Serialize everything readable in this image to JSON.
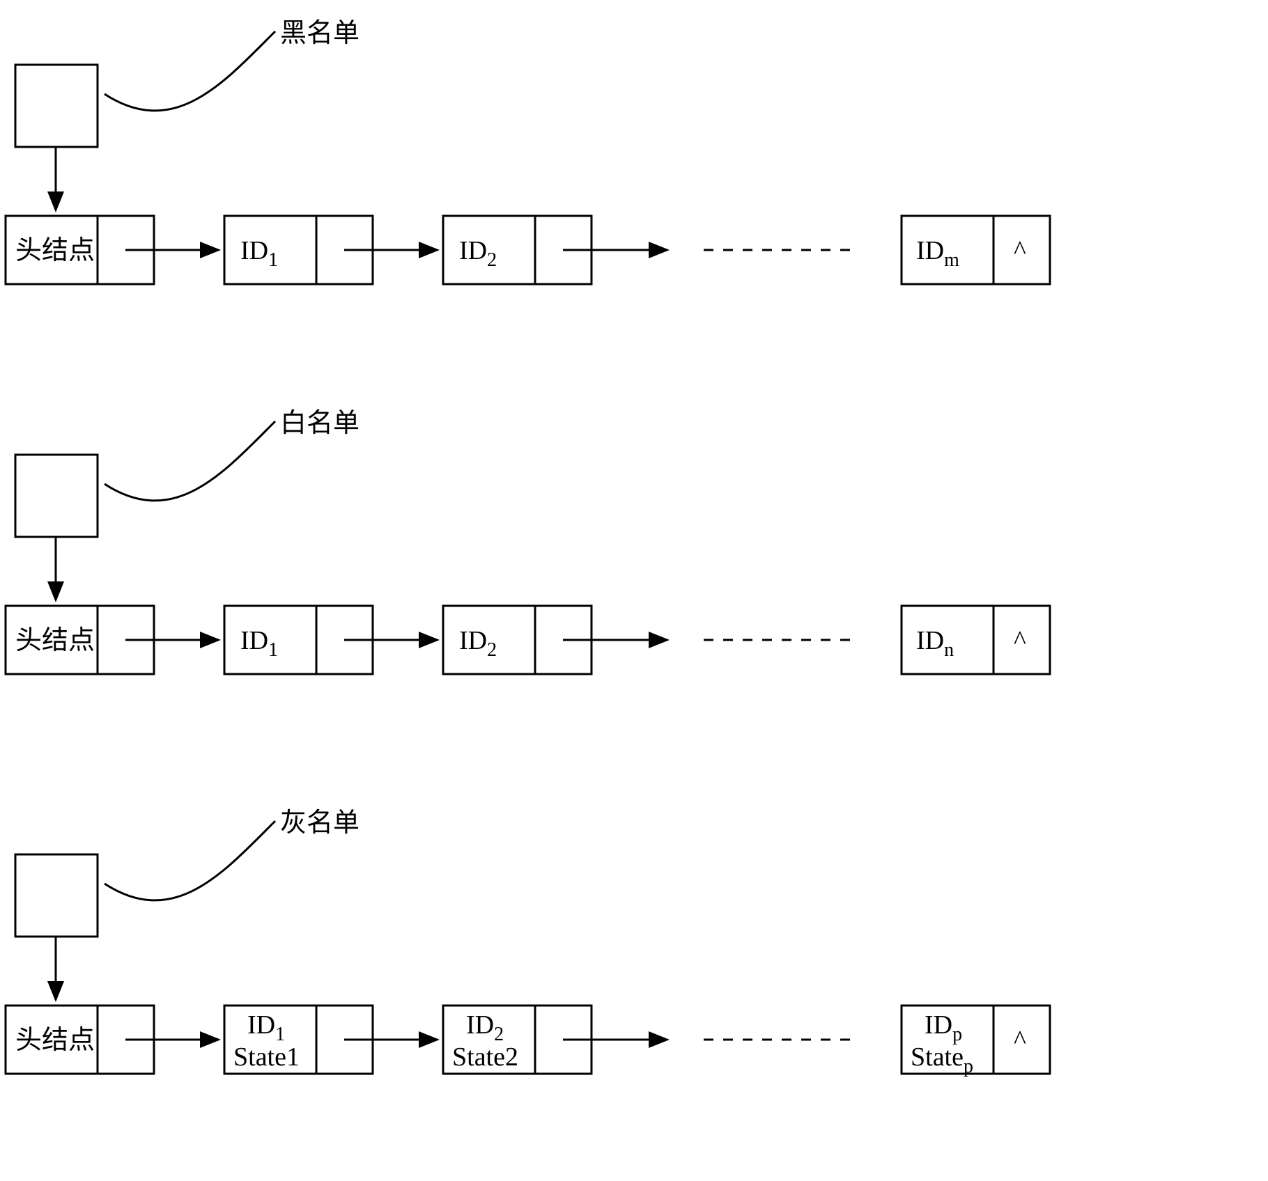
{
  "lists": [
    {
      "title": "黑名单",
      "head_label": "头结点",
      "nodes": [
        {
          "label_text": "ID",
          "label_sub": "1"
        },
        {
          "label_text": "ID",
          "label_sub": "2"
        }
      ],
      "last": {
        "label_text": "ID",
        "label_sub": "m",
        "terminator": "^"
      }
    },
    {
      "title": "白名单",
      "head_label": "头结点",
      "nodes": [
        {
          "label_text": "ID",
          "label_sub": "1"
        },
        {
          "label_text": "ID",
          "label_sub": "2"
        }
      ],
      "last": {
        "label_text": "ID",
        "label_sub": "n",
        "terminator": "^"
      }
    },
    {
      "title": "灰名单",
      "head_label": "头结点",
      "nodes": [
        {
          "label_text": "ID",
          "label_sub": "1",
          "state": "State1"
        },
        {
          "label_text": "ID",
          "label_sub": "2",
          "state": "State2"
        }
      ],
      "last": {
        "label_text": "ID",
        "label_sub": "p",
        "state_text": "State",
        "state_sub": "p",
        "terminator": "^"
      }
    }
  ]
}
